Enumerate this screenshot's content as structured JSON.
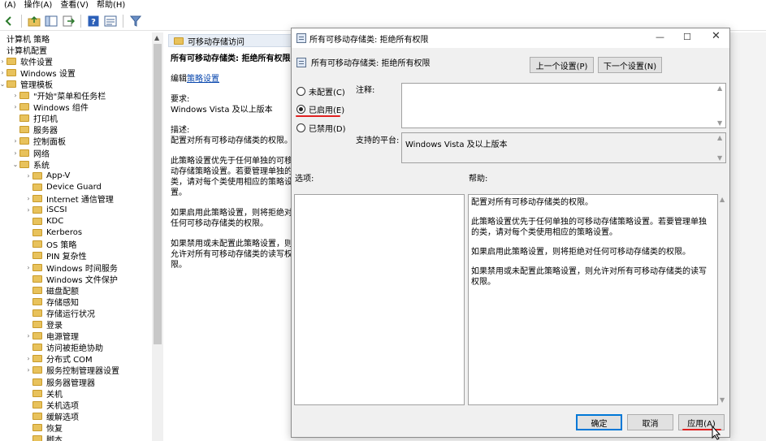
{
  "menu": [
    "(A)",
    "操作(A)",
    "查看(V)",
    "帮助(H)"
  ],
  "tree": {
    "items": [
      {
        "label": "计算机 策略",
        "indent": 0,
        "exp": "",
        "folder": false
      },
      {
        "label": "计算机配置",
        "indent": 0,
        "exp": "",
        "folder": false
      },
      {
        "label": "软件设置",
        "indent": 0,
        "exp": "›",
        "folder": true
      },
      {
        "label": "Windows 设置",
        "indent": 0,
        "exp": "›",
        "folder": true
      },
      {
        "label": "管理模板",
        "indent": 0,
        "exp": "⌄",
        "folder": true
      },
      {
        "label": "\"开始\"菜单和任务栏",
        "indent": 1,
        "exp": "›",
        "folder": true
      },
      {
        "label": "Windows 组件",
        "indent": 1,
        "exp": "›",
        "folder": true
      },
      {
        "label": "打印机",
        "indent": 1,
        "exp": "",
        "folder": true
      },
      {
        "label": "服务器",
        "indent": 1,
        "exp": "",
        "folder": true
      },
      {
        "label": "控制面板",
        "indent": 1,
        "exp": "›",
        "folder": true
      },
      {
        "label": "网络",
        "indent": 1,
        "exp": "›",
        "folder": true
      },
      {
        "label": "系统",
        "indent": 1,
        "exp": "⌄",
        "folder": true
      },
      {
        "label": "App-V",
        "indent": 2,
        "exp": "›",
        "folder": true
      },
      {
        "label": "Device Guard",
        "indent": 2,
        "exp": "",
        "folder": true
      },
      {
        "label": "Internet 通信管理",
        "indent": 2,
        "exp": "›",
        "folder": true
      },
      {
        "label": "iSCSI",
        "indent": 2,
        "exp": "›",
        "folder": true
      },
      {
        "label": "KDC",
        "indent": 2,
        "exp": "",
        "folder": true
      },
      {
        "label": "Kerberos",
        "indent": 2,
        "exp": "",
        "folder": true
      },
      {
        "label": "OS 策略",
        "indent": 2,
        "exp": "",
        "folder": true
      },
      {
        "label": "PIN 复杂性",
        "indent": 2,
        "exp": "",
        "folder": true
      },
      {
        "label": "Windows 时间服务",
        "indent": 2,
        "exp": "›",
        "folder": true
      },
      {
        "label": "Windows 文件保护",
        "indent": 2,
        "exp": "",
        "folder": true
      },
      {
        "label": "磁盘配额",
        "indent": 2,
        "exp": "",
        "folder": true
      },
      {
        "label": "存储感知",
        "indent": 2,
        "exp": "",
        "folder": true
      },
      {
        "label": "存储运行状况",
        "indent": 2,
        "exp": "",
        "folder": true
      },
      {
        "label": "登录",
        "indent": 2,
        "exp": "",
        "folder": true
      },
      {
        "label": "电源管理",
        "indent": 2,
        "exp": "›",
        "folder": true
      },
      {
        "label": "访问被拒绝协助",
        "indent": 2,
        "exp": "",
        "folder": true
      },
      {
        "label": "分布式 COM",
        "indent": 2,
        "exp": "›",
        "folder": true
      },
      {
        "label": "服务控制管理器设置",
        "indent": 2,
        "exp": "›",
        "folder": true
      },
      {
        "label": "服务器管理器",
        "indent": 2,
        "exp": "",
        "folder": true
      },
      {
        "label": "关机",
        "indent": 2,
        "exp": "",
        "folder": true
      },
      {
        "label": "关机选项",
        "indent": 2,
        "exp": "",
        "folder": true
      },
      {
        "label": "缓解选项",
        "indent": 2,
        "exp": "",
        "folder": true
      },
      {
        "label": "恢复",
        "indent": 2,
        "exp": "",
        "folder": true
      },
      {
        "label": "脚本",
        "indent": 2,
        "exp": "",
        "folder": true
      }
    ]
  },
  "detail": {
    "header": "可移动存储访问",
    "title": "所有可移动存储类: 拒绝所有权限",
    "edit_prefix": "编辑",
    "edit_link": "策略设置",
    "requirements_label": "要求:",
    "requirements_value": "Windows Vista 及以上版本",
    "description_label": "描述:",
    "description_value": "配置对所有可移动存储类的权限。",
    "para1": "此策略设置优先于任何单独的可移动存储策略设置。若要管理单独的类，请对每个类使用相应的策略设置。",
    "para2": "如果启用此策略设置，则将拒绝对任何可移动存储类的权限。",
    "para3": "如果禁用或未配置此策略设置，则允许对所有可移动存储类的读写权限。"
  },
  "dialog": {
    "title": "所有可移动存储类: 拒绝所有权限",
    "subtitle": "所有可移动存储类: 拒绝所有权限",
    "prev_button": "上一个设置(P)",
    "next_button": "下一个设置(N)",
    "radio_not_configured": "未配置(C)",
    "radio_enabled": "已启用(E)",
    "radio_disabled": "已禁用(D)",
    "comment_label": "注释:",
    "platform_label": "支持的平台:",
    "platform_value": "Windows Vista 及以上版本",
    "options_label": "选项:",
    "help_label": "帮助:",
    "help_p1": "配置对所有可移动存储类的权限。",
    "help_p2": "此策略设置优先于任何单独的可移动存储策略设置。若要管理单独的类，请对每个类使用相应的策略设置。",
    "help_p3": "如果启用此策略设置，则将拒绝对任何可移动存储类的权限。",
    "help_p4": "如果禁用或未配置此策略设置，则允许对所有可移动存储类的读写权限。",
    "ok_button": "确定",
    "cancel_button": "取消",
    "apply_button": "应用(A)",
    "selected": "enabled"
  },
  "colors": {
    "annotation_red": "#e02020",
    "folder_yellow": "#e8c25c"
  }
}
